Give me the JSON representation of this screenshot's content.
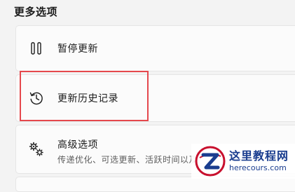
{
  "section": {
    "title": "更多选项"
  },
  "options": {
    "pause": {
      "label": "暂停更新",
      "icon": "pause-icon"
    },
    "history": {
      "label": "更新历史记录",
      "icon": "history-icon"
    },
    "advanced": {
      "label": "高级选项",
      "description": "传递优化、可选更新、活跃时间以及",
      "icon": "gears-icon"
    }
  },
  "watermark": {
    "title": "这里教程网",
    "url": "herecours.com",
    "logo": "z-logo-icon"
  },
  "colors": {
    "highlight": "#e5484d",
    "watermark": "#1a3d8f"
  }
}
